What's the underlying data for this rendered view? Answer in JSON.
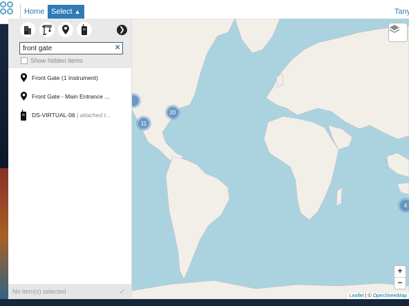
{
  "topbar": {
    "home_label": "Home",
    "select_label": "Select",
    "user_label": "Tanya"
  },
  "panel": {
    "type_icons": [
      "building-icon",
      "crane-icon",
      "location-pin-icon",
      "instrument-icon"
    ],
    "search": {
      "value": "front gate",
      "clear_icon": "✕"
    },
    "show_hidden_label": "Show hidden items",
    "results": [
      {
        "icon": "location-pin-icon",
        "label": "Front Gate (1 Instrument)",
        "note": ""
      },
      {
        "icon": "location-pin-icon",
        "label": "Front Gate - Main Entrance ...",
        "note": ""
      },
      {
        "icon": "instrument-icon",
        "label": "DS-VIRTUAL-06",
        "note": "| attached t..."
      }
    ],
    "footer_text": "No item(s) selected"
  },
  "map": {
    "clusters": [
      {
        "label": "20"
      },
      {
        "label": "11"
      },
      {
        "label": ""
      },
      {
        "label": "4"
      }
    ],
    "zoom_in": "+",
    "zoom_out": "−",
    "attribution_leaflet": "Leaflet",
    "attribution_sep": " | © ",
    "attribution_osm": "OpenStreetMap"
  }
}
